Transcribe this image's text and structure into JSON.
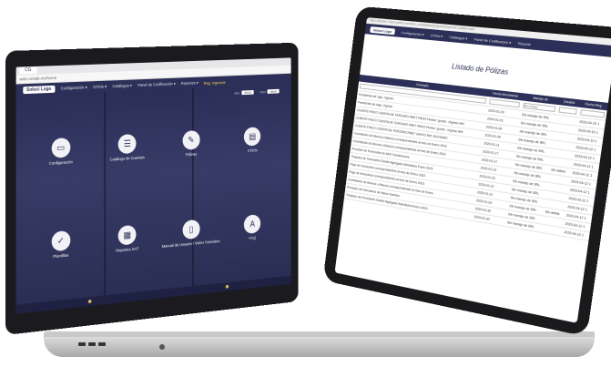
{
  "laptop": {
    "tab_label": "CG",
    "url": "web.contab.mx/home",
    "logo": "Soluci Logo",
    "nav": [
      "Configuración ▾",
      "CFDIs ▾",
      "Catálogos ▾",
      "Panel de Codificación ▾",
      "Reportes ▾"
    ],
    "nav_highlight": "Reg. Ingresos",
    "select_year_label": "Año",
    "select_year_value": "2023",
    "select_month_label": "Mes",
    "select_month_value": "Abril",
    "tiles": [
      {
        "label": "Configuración",
        "icon": "▭"
      },
      {
        "label": "Catálogo de Cuentas",
        "icon": "☰"
      },
      {
        "label": "Pólizas",
        "icon": "✎"
      },
      {
        "label": "CFDIs",
        "icon": "▤"
      },
      {
        "label": "Plantillas",
        "icon": "✓"
      },
      {
        "label": "Reportes SAT",
        "icon": "▦"
      },
      {
        "label": "Manual de Usuario / Video Tutoriales",
        "icon": "▯"
      },
      {
        "label": "FAQ",
        "icon": "A"
      }
    ]
  },
  "tablet": {
    "url": "https://dj-web-2-fact-contab.mx/index_contabilidad/polizas/listado?id=1&filtro=abril",
    "logo": "Soluci Logo",
    "nav": [
      "Configuración ▾",
      "CFDIs ▾",
      "Catálogos ▾",
      "Panel de Codificación ▾",
      "Reporte"
    ],
    "title": "Listado de Pólizas",
    "columns": [
      "Concepto",
      "Fecha Movimiento",
      "Manejo de",
      "Usuario",
      "Fecha Reg."
    ],
    "filter_value": "Sin manejo",
    "rows": [
      {
        "concepto": "Pendientes de caja - Egreso",
        "fecha": "2023-01-03",
        "manejo": "Sin manejo de SRL",
        "usuario": "",
        "registro": "2023-04-10 1"
      },
      {
        "concepto": "Pendientes de caja - Egreso",
        "fecha": "2023-01-03",
        "manejo": "Sin manejo de SRL",
        "usuario": "",
        "registro": "2023-04-10 1"
      },
      {
        "concepto": "CLIENTE FINCO CUENTA DE TERCERO RNET PAGO Invoice: goods - Ingreso Ref",
        "fecha": "2023-01-06",
        "manejo": "Sin manejo de SRL",
        "usuario": "",
        "registro": "2023-04-10 1"
      },
      {
        "concepto": "CLIENTE FINCO CUENTA DE TERCERO RNET PAGO Invoice: goods - Ingreso Ref",
        "fecha": "2023-01-06",
        "manejo": "Sin manejo de SRL",
        "usuario": "",
        "registro": "2023-04-12 1"
      },
      {
        "concepto": "CLIENTE FINCO CUENTA DE TERCERO RNET GASTO Ref: 302763967",
        "fecha": "2023-01-11",
        "manejo": "Sin manejo de SRL",
        "usuario": "",
        "registro": "2023-04-12 1"
      },
      {
        "concepto": "Conciliación de Abonos a Bancos correspondientes al mes de Enero 2023",
        "fecha": "2023-01-17",
        "manejo": "Sin manejo de SRL",
        "usuario": "",
        "registro": "2023-04-12 1"
      },
      {
        "concepto": "Conciliación de Abonos a Bancos correspondientes al mes de Enero 2023",
        "fecha": "2023-01-17",
        "manejo": "Sin manejo de SRL",
        "usuario": "Sin definir",
        "registro": "2023-04-12 1"
      },
      {
        "concepto": "Provisión de Honorarios de Abril Transferencia",
        "fecha": "2023-01-19",
        "manejo": "Sin manejo de SRL",
        "usuario": "",
        "registro": "2023-04-12 1"
      },
      {
        "concepto": "Traspaso de Honorarios Sueldo Agregado Asimilados Enero 2023",
        "fecha": "2023-01-20",
        "manejo": "Sin manejo de SRL",
        "usuario": "",
        "registro": "2023-04-12 1"
      },
      {
        "concepto": "Pago de Honorarios correspondientes al mes de Enero 2023",
        "fecha": "2023-01-21",
        "manejo": "Sin manejo de SRL",
        "usuario": "",
        "registro": "2023-04-12 1"
      },
      {
        "concepto": "Pago de Honorarios correspondientes al mes de Enero 2023",
        "fecha": "2023-01-21",
        "manejo": "Sin manejo de SRL",
        "usuario": "",
        "registro": "2023-04-12 1"
      },
      {
        "concepto": "Conciliación de Abonos a Bancos correspondientes al mes de Enero",
        "fecha": "2023-01-23",
        "manejo": "Sin manejo de SRL",
        "usuario": "Sin definir",
        "registro": "2023-04-12 1"
      },
      {
        "concepto": "Provisión de Honorarios de Marzo Sueldos",
        "fecha": "2023-01-30",
        "manejo": "Sin manejo de SRL",
        "usuario": "",
        "registro": "2023-04-12 1"
      },
      {
        "concepto": "Traspaso de Honorarios Sueldo Agregado Asimilados Enero 2023",
        "fecha": "2023-01-30",
        "manejo": "Sin manejo de SRL",
        "usuario": "",
        "registro": "2023-04-12 1"
      }
    ]
  }
}
